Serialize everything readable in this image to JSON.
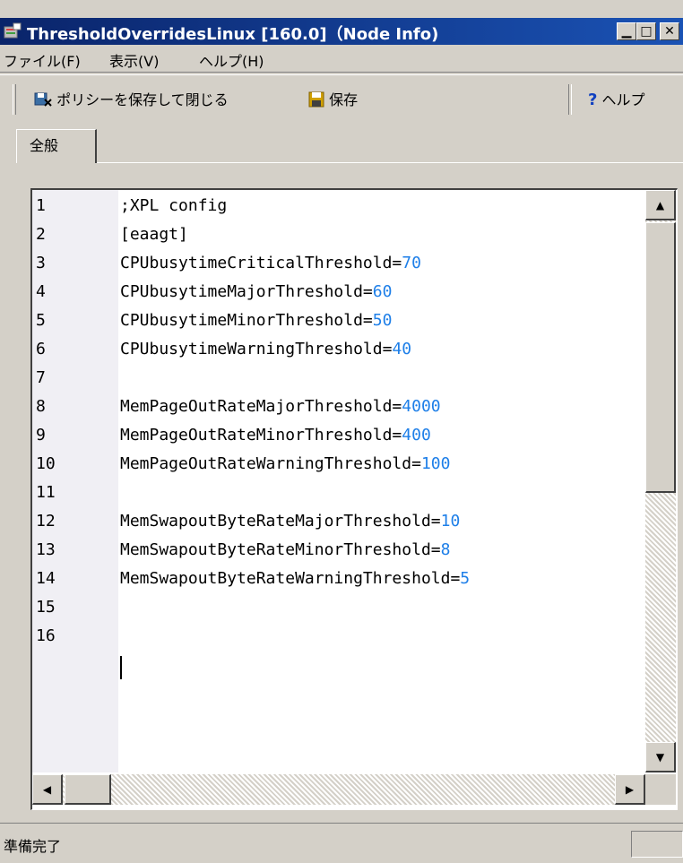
{
  "window": {
    "title": "ThresholdOverridesLinux [160.0]（Node Info)"
  },
  "menu": [
    {
      "label": "ファイル(F)"
    },
    {
      "label": "表示(V)"
    },
    {
      "label": "ヘルプ(H)"
    }
  ],
  "toolbar": {
    "save_close_label": "ポリシーを保存して閉じる",
    "save_label": "保存",
    "help_label": "ヘルプ"
  },
  "tabs": [
    {
      "label": "全般"
    }
  ],
  "editor": {
    "lines": [
      {
        "n": "1",
        "key": ";XPL config",
        "val": ""
      },
      {
        "n": "2",
        "key": "[eaagt]",
        "val": ""
      },
      {
        "n": "3",
        "key": "CPUbusytimeCriticalThreshold=",
        "val": "70"
      },
      {
        "n": "4",
        "key": "CPUbusytimeMajorThreshold=",
        "val": "60"
      },
      {
        "n": "5",
        "key": "CPUbusytimeMinorThreshold=",
        "val": "50"
      },
      {
        "n": "6",
        "key": "CPUbusytimeWarningThreshold=",
        "val": "40"
      },
      {
        "n": "7",
        "key": "",
        "val": ""
      },
      {
        "n": "8",
        "key": "MemPageOutRateMajorThreshold=",
        "val": "4000"
      },
      {
        "n": "9",
        "key": "MemPageOutRateMinorThreshold=",
        "val": "400"
      },
      {
        "n": "10",
        "key": "MemPageOutRateWarningThreshold=",
        "val": "100"
      },
      {
        "n": "11",
        "key": "",
        "val": ""
      },
      {
        "n": "12",
        "key": "MemSwapoutByteRateMajorThreshold=",
        "val": "10"
      },
      {
        "n": "13",
        "key": "MemSwapoutByteRateMinorThreshold=",
        "val": "8"
      },
      {
        "n": "14",
        "key": "MemSwapoutByteRateWarningThreshold=",
        "val": "5"
      },
      {
        "n": "15",
        "key": "",
        "val": ""
      },
      {
        "n": "16",
        "key": "",
        "val": ""
      }
    ]
  },
  "status": {
    "text": "準備完了"
  },
  "colors": {
    "title_bar": "#0a246a",
    "value_text": "#1e7fe8",
    "chrome": "#d4d0c8"
  }
}
